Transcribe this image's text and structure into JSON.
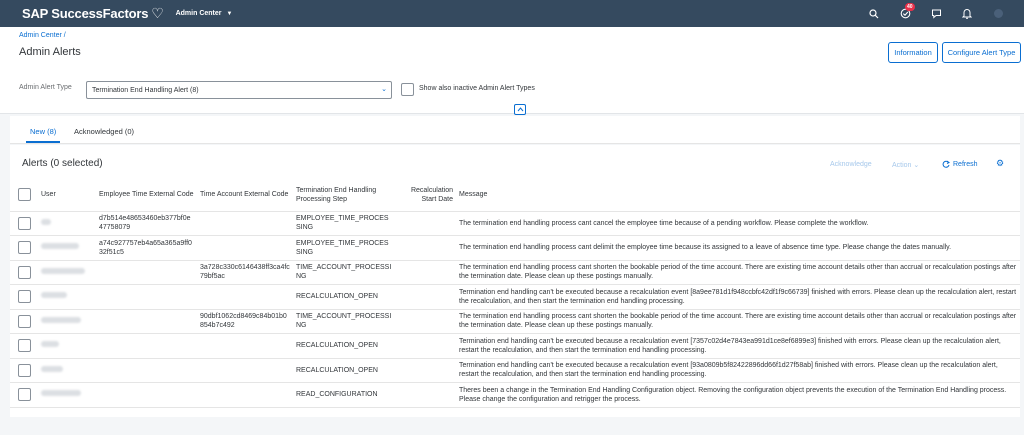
{
  "shell": {
    "brand": "SAP SuccessFactors",
    "module": "Admin Center",
    "notification_count": "40",
    "icons": [
      "search-icon",
      "approvals-icon",
      "feedback-icon",
      "bell-icon",
      "user-icon"
    ]
  },
  "header": {
    "breadcrumb": "Admin Center /",
    "title": "Admin Alerts",
    "information_button": "Information",
    "configure_button": "Configure Alert Type",
    "filter_label": "Admin Alert Type",
    "filter_value": "Termination End Handling Alert (8)",
    "inactive_label": "Show also inactive Admin Alert Types"
  },
  "tabs": [
    {
      "label": "New (8)",
      "selected": true
    },
    {
      "label": "Acknowledged (0)",
      "selected": false
    }
  ],
  "table": {
    "title": "Alerts (0 selected)",
    "acknowledge_label": "Acknowledge",
    "action_label": "Action",
    "refresh_label": "Refresh",
    "columns": {
      "user": "User",
      "emp_time": "Employee Time External Code",
      "acct_time": "Time Account External Code",
      "step": "Termination End Handling Processing Step",
      "recalc": "Recalculation Start Date",
      "message": "Message"
    },
    "rows": [
      {
        "emp_time": "d7b514e48653460eb377bf0e47758079",
        "acct_time": "",
        "step": "EMPLOYEE_TIME_PROCESSING",
        "recalc": "",
        "message": "The termination end handling process cant cancel the employee time because of a pending workflow. Please complete the workflow."
      },
      {
        "emp_time": "a74c927757eb4a65a365a9ff032f51c5",
        "acct_time": "",
        "step": "EMPLOYEE_TIME_PROCESSING",
        "recalc": "",
        "message": "The termination end handling process cant delimit the employee time because its assigned to a leave of absence time type. Please change the dates manually."
      },
      {
        "emp_time": "",
        "acct_time": "3a728c330c6146438ff3ca4fc79bf5ac",
        "step": "TIME_ACCOUNT_PROCESSING",
        "recalc": "",
        "message": "The termination end handling process cant shorten the bookable period of the time account. There are existing time account details other than accrual or recalculation postings after the termination date. Please clean up these postings manually."
      },
      {
        "emp_time": "",
        "acct_time": "",
        "step": "RECALCULATION_OPEN",
        "recalc": "",
        "message": "Termination end handling can't be executed because a recalculation event [8a9ee781d1f948ccbfc42df1f9c66739] finished with errors. Please clean up the recalculation alert, restart the recalculation, and then start the termination end handling processing."
      },
      {
        "emp_time": "",
        "acct_time": "90dbf1062cd8469c84b01b0854b7c492",
        "step": "TIME_ACCOUNT_PROCESSING",
        "recalc": "",
        "message": "The termination end handling process cant shorten the bookable period of the time account. There are existing time account details other than accrual or recalculation postings after the termination date. Please clean up these postings manually."
      },
      {
        "emp_time": "",
        "acct_time": "",
        "step": "RECALCULATION_OPEN",
        "recalc": "",
        "message": "Termination end handling can't be executed because a recalculation event [7357c02d4e7843ea991d1ce8ef6899e3] finished with errors. Please clean up the recalculation alert, restart the recalculation, and then start the termination end handling processing."
      },
      {
        "emp_time": "",
        "acct_time": "",
        "step": "RECALCULATION_OPEN",
        "recalc": "",
        "message": "Termination end handling can't be executed because a recalculation event [93a0809b5f82422896dd66f1d27f58ab] finished with errors. Please clean up the recalculation alert, restart the recalculation, and then start the termination end handling processing."
      },
      {
        "emp_time": "",
        "acct_time": "",
        "step": "READ_CONFIGURATION",
        "recalc": "",
        "message": "Theres been a change in the Termination End Handling Configuration object. Removing the configuration object prevents the execution of the Termination End Handling process. Please change the configuration and retrigger the process."
      }
    ]
  },
  "colors": {
    "shell": "#354a5f",
    "accent": "#0a6ed1",
    "badge": "#e9304a"
  }
}
